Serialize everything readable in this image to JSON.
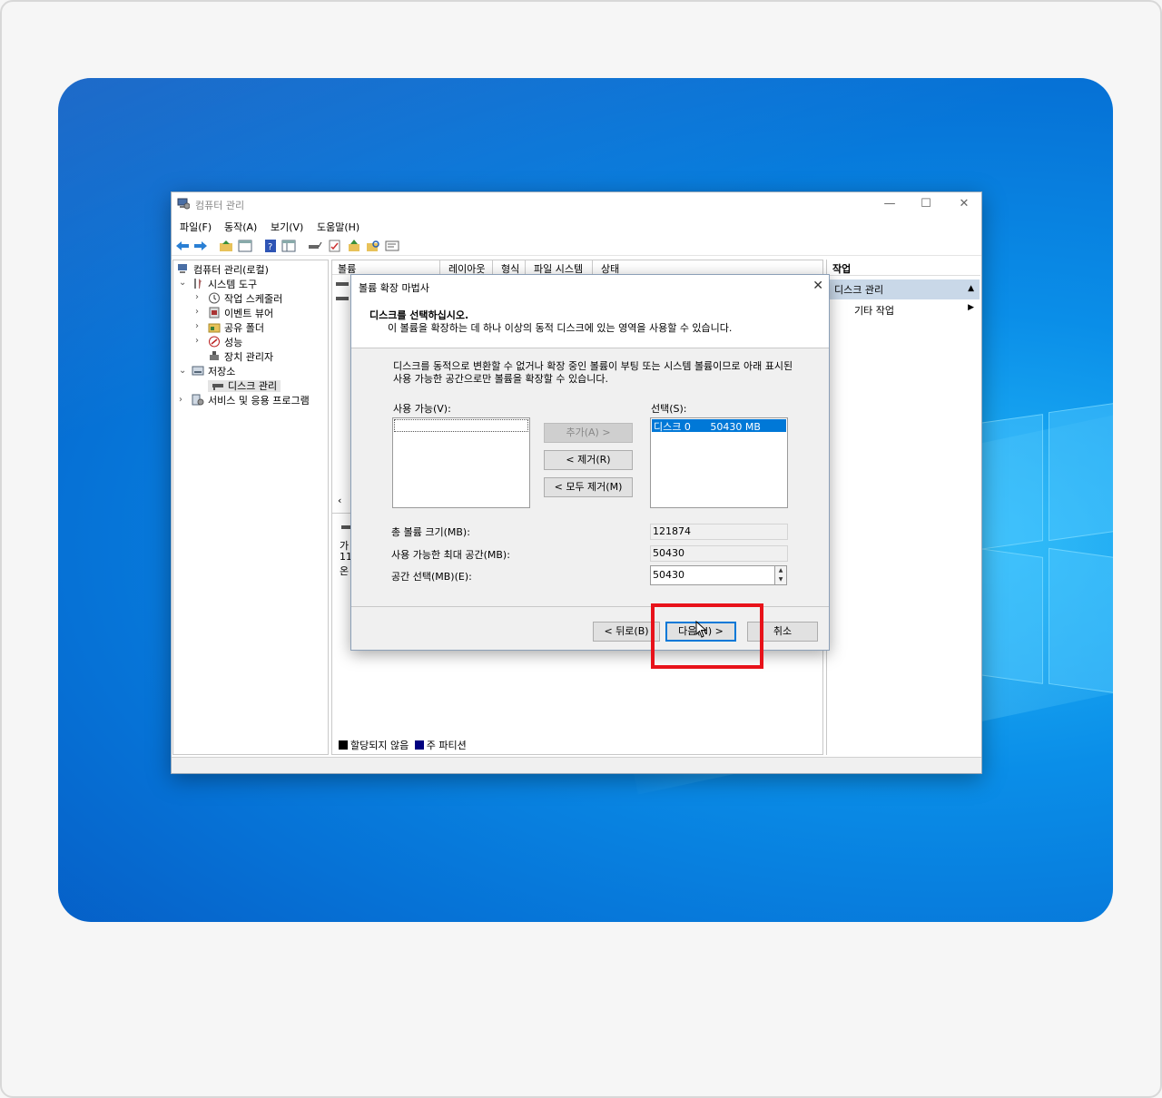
{
  "window": {
    "title": "컴퓨터 관리",
    "controls": [
      "—",
      "☐",
      "✕"
    ]
  },
  "menu": [
    "파일(F)",
    "동작(A)",
    "보기(V)",
    "도움말(H)"
  ],
  "tree": {
    "root": "컴퓨터 관리(로컬)",
    "system_tools": "시스템 도구",
    "task_scheduler": "작업 스케줄러",
    "event_viewer": "이벤트 뷰어",
    "shared_folders": "공유 폴더",
    "performance": "성능",
    "device_manager": "장치 관리자",
    "storage": "저장소",
    "disk_management": "디스크 관리",
    "services": "서비스 및 응용 프로그램"
  },
  "columns": [
    "볼륨",
    "레이아웃",
    "형식",
    "파일 시스템",
    "상태"
  ],
  "bottom_pane_fragments": [
    "가",
    "11",
    "온"
  ],
  "legend": {
    "unallocated": "할당되지 않음",
    "primary": "주 파티션",
    "colors": {
      "unallocated": "#000000",
      "primary": "#000080"
    }
  },
  "actions": {
    "header": "작업",
    "group": "디스크 관리",
    "more": "기타 작업"
  },
  "dialog": {
    "title": "볼륨 확장 마법사",
    "heading": "디스크를 선택하십시오.",
    "subheading": "이 볼륨을 확장하는 데 하나 이상의 동적 디스크에 있는 영역을 사용할 수 있습니다.",
    "description": "디스크를 동적으로 변환할 수 없거나 확장 중인 볼륨이 부팅 또는 시스템 볼륨이므로 아래 표시된 사용 가능한 공간으로만 볼륨을 확장할 수 있습니다.",
    "available_label": "사용 가능(V):",
    "selected_label": "선택(S):",
    "selected_items": [
      {
        "disk": "디스크 0",
        "size": "50430 MB"
      }
    ],
    "add_button": "추가(A) >",
    "remove_button": "< 제거(R)",
    "remove_all_button": "< 모두 제거(M)",
    "total_label": "총 볼륨 크기(MB):",
    "total_value": "121874",
    "max_label": "사용 가능한 최대 공간(MB):",
    "max_value": "50430",
    "select_label": "공간 선택(MB)(E):",
    "select_value": "50430",
    "back_button": "< 뒤로(B)",
    "next_button": "다음(N) >",
    "cancel_button": "취소"
  },
  "colors": {
    "accent": "#0078d7",
    "highlight_box": "#e8121a",
    "selection": "#0078d7"
  }
}
